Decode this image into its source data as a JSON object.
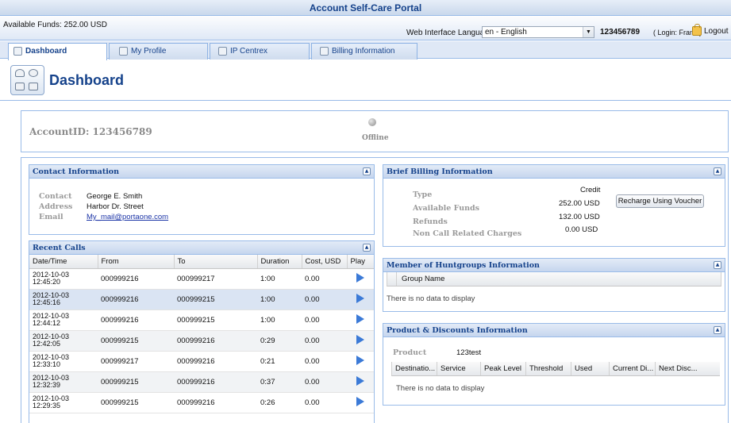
{
  "app": {
    "title": "Account Self-Care Portal"
  },
  "topbar": {
    "funds": "Available Funds: 252.00 USD",
    "lang_label": "Web Interface Language:",
    "lang_value": "en - English",
    "account_id": "123456789",
    "login_text": "( Login: Frank )",
    "logout_label": "Logout"
  },
  "tabs": [
    {
      "label": "Dashboard",
      "icon": "dashboard-icon"
    },
    {
      "label": "My Profile",
      "icon": "profile-icon"
    },
    {
      "label": "IP Centrex",
      "icon": "centrex-icon"
    },
    {
      "label": "Billing Information",
      "icon": "billing-icon"
    }
  ],
  "page": {
    "title": "Dashboard"
  },
  "account": {
    "id_text": "AccountID: 123456789",
    "status": "Offline"
  },
  "contact": {
    "title": "Contact Information",
    "contact_label": "Contact",
    "contact_value": "George E. Smith",
    "address_label": "Address",
    "address_value": "Harbor Dr. Street",
    "email_label": "Email",
    "email_value": "My_mail@portaone.com"
  },
  "calls": {
    "title": "Recent Calls",
    "columns": [
      "Date/Time",
      "From",
      "To",
      "Duration",
      "Cost, USD",
      "Play"
    ],
    "rows": [
      {
        "date": "2012-10-03",
        "time": "12:45:20",
        "from": "000999216",
        "to": "000999217",
        "duration": "1:00",
        "cost": "0.00"
      },
      {
        "date": "2012-10-03",
        "time": "12:45:16",
        "from": "000999216",
        "to": "000999215",
        "duration": "1:00",
        "cost": "0.00"
      },
      {
        "date": "2012-10-03",
        "time": "12:44:12",
        "from": "000999216",
        "to": "000999215",
        "duration": "1:00",
        "cost": "0.00"
      },
      {
        "date": "2012-10-03",
        "time": "12:42:05",
        "from": "000999215",
        "to": "000999216",
        "duration": "0:29",
        "cost": "0.00"
      },
      {
        "date": "2012-10-03",
        "time": "12:33:10",
        "from": "000999217",
        "to": "000999216",
        "duration": "0:21",
        "cost": "0.00"
      },
      {
        "date": "2012-10-03",
        "time": "12:32:39",
        "from": "000999215",
        "to": "000999216",
        "duration": "0:37",
        "cost": "0.00"
      },
      {
        "date": "2012-10-03",
        "time": "12:29:35",
        "from": "000999215",
        "to": "000999216",
        "duration": "0:26",
        "cost": "0.00"
      }
    ]
  },
  "billing": {
    "title": "Brief Billing Information",
    "type_label": "Type",
    "type_value": "Credit",
    "funds_label": "Available Funds",
    "funds_value": "252.00 USD",
    "refunds_label": "Refunds",
    "refunds_value": "132.00 USD",
    "noncall_label": "Non Call Related Charges",
    "noncall_value": "0.00 USD",
    "recharge_label": "Recharge Using Voucher"
  },
  "huntgroups": {
    "title": "Member of Huntgroups Information",
    "column": "Group Name",
    "empty": "There is no data to display"
  },
  "products": {
    "title": "Product & Discounts Information",
    "product_label": "Product",
    "product_value": "123test",
    "columns": [
      "Destinatio...",
      "Service",
      "Peak Level",
      "Threshold",
      "Used",
      "Current Di...",
      "Next Disc..."
    ],
    "empty": "There is no data to display"
  }
}
